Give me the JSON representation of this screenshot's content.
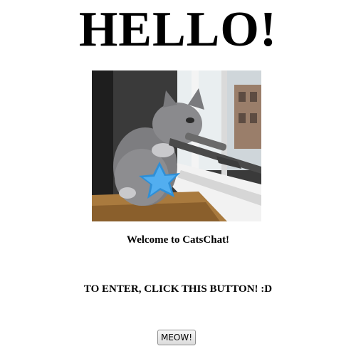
{
  "header": {
    "title": "HELLO!"
  },
  "hero_image": {
    "icon": "kitten-with-rifle-photo"
  },
  "main": {
    "welcome_text": "Welcome to CatsChat!",
    "instruction_text": "TO ENTER, CLICK THIS BUTTON! :D",
    "enter_button_label": "MEOW!"
  }
}
